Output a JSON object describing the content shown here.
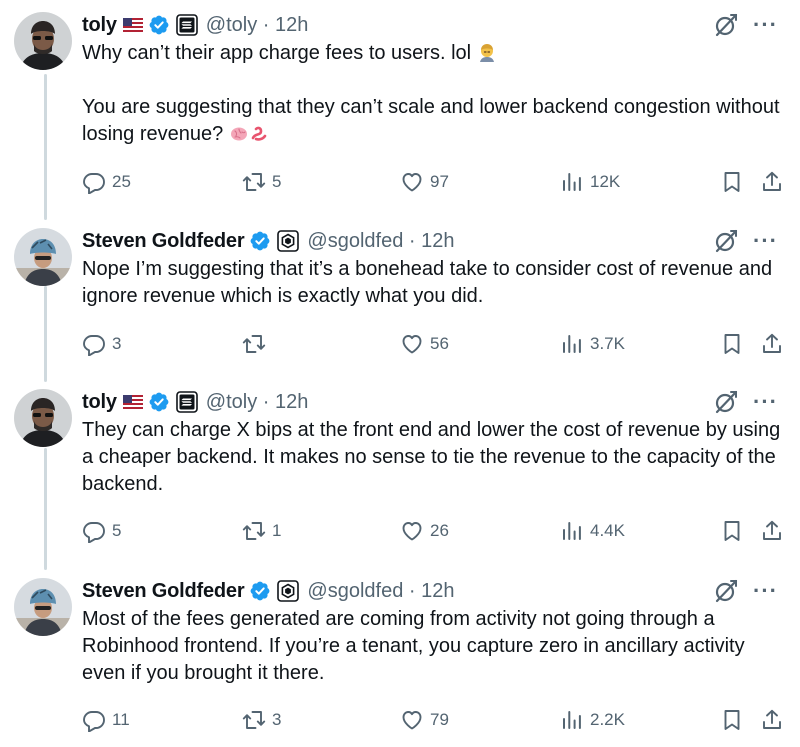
{
  "tweets": [
    {
      "author": {
        "name": "toly",
        "handle": "@toly",
        "time": "12h",
        "avatar": "toly-avatar",
        "flag": "us-flag-icon",
        "affiliate": "solana-badge-icon"
      },
      "paragraphs": [
        "Why can’t their app charge fees to users. lol",
        "You are suggesting that they can’t scale and lower backend congestion without losing revenue?"
      ],
      "stats": {
        "replies": "25",
        "retweets": "5",
        "likes": "97",
        "views": "12K"
      }
    },
    {
      "author": {
        "name": "Steven Goldfeder",
        "handle": "@sgoldfed",
        "time": "12h",
        "avatar": "steven-avatar",
        "affiliate": "offchain-labs-badge-icon"
      },
      "paragraphs": [
        "Nope I’m suggesting that it’s a bonehead take to consider cost of revenue and ignore revenue which is exactly what you did."
      ],
      "stats": {
        "replies": "3",
        "retweets": "",
        "likes": "56",
        "views": "3.7K"
      }
    },
    {
      "author": {
        "name": "toly",
        "handle": "@toly",
        "time": "12h",
        "avatar": "toly-avatar",
        "flag": "us-flag-icon",
        "affiliate": "solana-badge-icon"
      },
      "paragraphs": [
        "They can charge X bips at the front end and lower the cost of revenue by using a cheaper backend. It makes no sense to tie the revenue to the capacity of the backend."
      ],
      "stats": {
        "replies": "5",
        "retweets": "1",
        "likes": "26",
        "views": "4.4K"
      }
    },
    {
      "author": {
        "name": "Steven Goldfeder",
        "handle": "@sgoldfed",
        "time": "12h",
        "avatar": "steven-avatar",
        "affiliate": "offchain-labs-badge-icon"
      },
      "paragraphs": [
        "Most of the fees generated are coming from activity not going through a Robinhood frontend. If you’re a tenant, you capture zero in ancillary activity even if you brought it there."
      ],
      "stats": {
        "replies": "11",
        "retweets": "3",
        "likes": "79",
        "views": "2.2K"
      }
    }
  ],
  "separator": "·",
  "colors": {
    "verified": "#1d9bf0",
    "text": "#0f1419",
    "muted": "#536471",
    "thread_line": "#cfd9de"
  }
}
